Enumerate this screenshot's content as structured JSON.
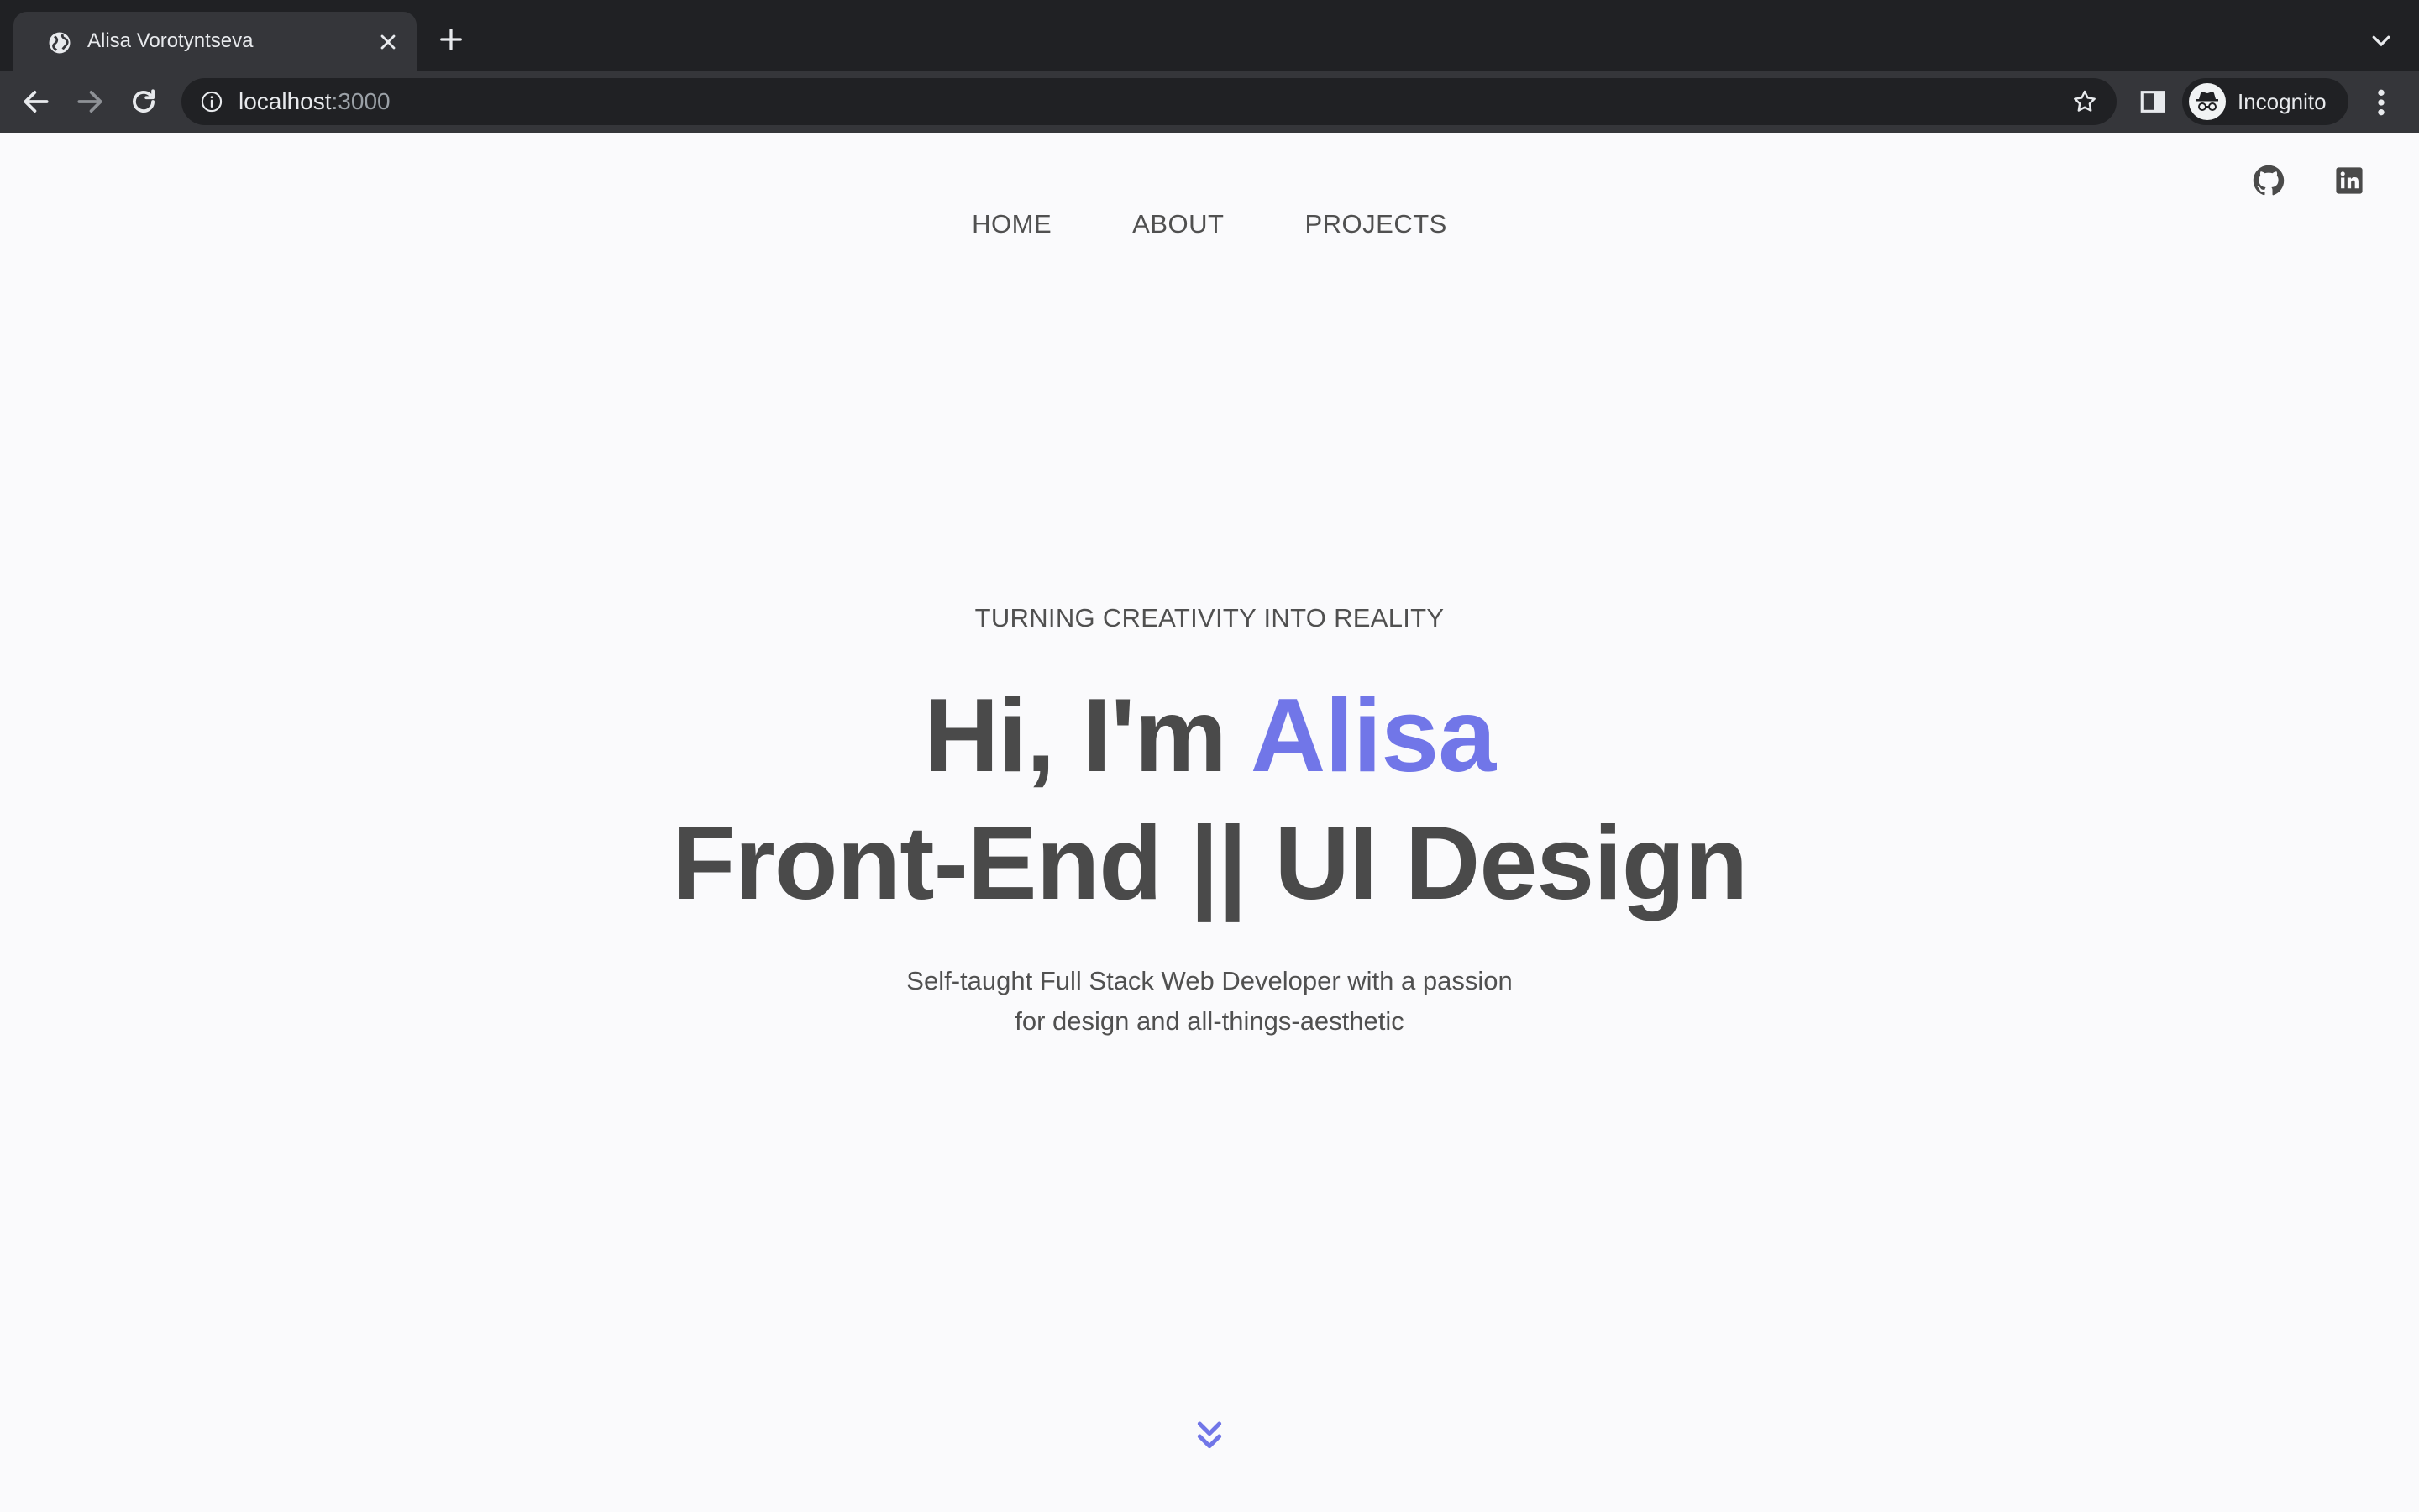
{
  "browser": {
    "tab_title": "Alisa Vorotyntseva",
    "url_host": "localhost",
    "url_port": ":3000",
    "profile_label": "Incognito"
  },
  "nav": {
    "items": [
      {
        "label": "HOME"
      },
      {
        "label": "ABOUT"
      },
      {
        "label": "PROJECTS"
      }
    ]
  },
  "social": {
    "icons": [
      "github-icon",
      "linkedin-icon"
    ]
  },
  "hero": {
    "tagline": "TURNING CREATIVITY INTO REALITY",
    "greeting": "Hi, I'm ",
    "name": "Alisa",
    "role": "Front-End || UI Design",
    "subtitle_line1": "Self-taught Full Stack Web Developer with a passion",
    "subtitle_line2": "for design and all-things-aesthetic"
  },
  "colors": {
    "accent": "#7176e8",
    "text": "#4a4a4a",
    "background": "#fafafc",
    "chrome_dark": "#202124",
    "chrome_mid": "#35363a"
  }
}
